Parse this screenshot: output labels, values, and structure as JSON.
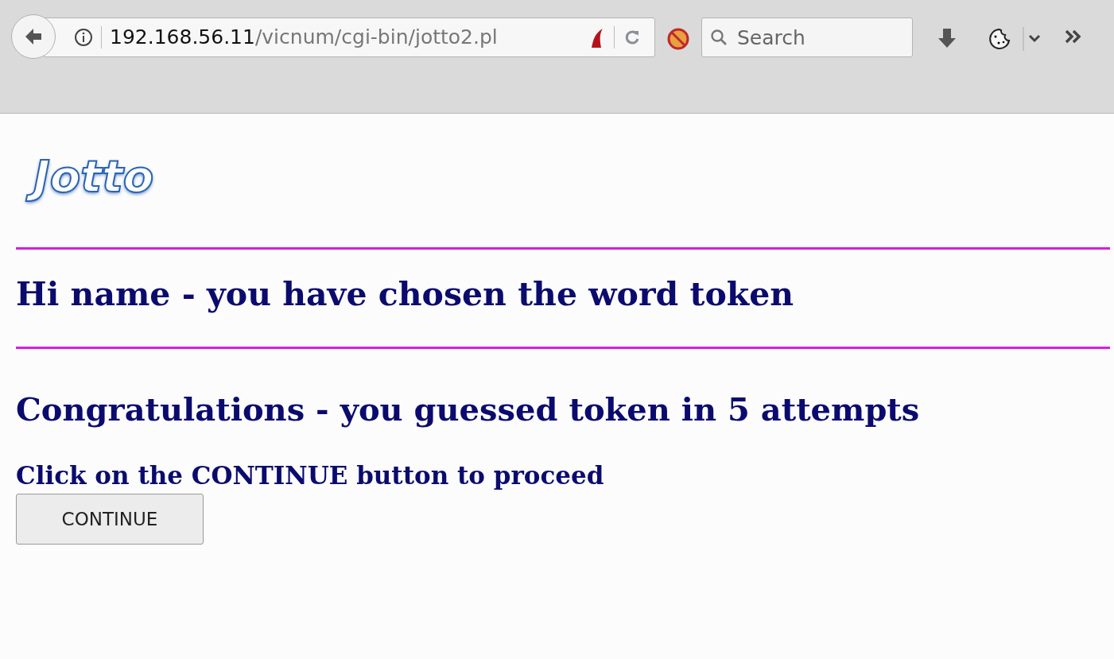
{
  "browser": {
    "url": {
      "host": "192.168.56.11",
      "path": "/vicnum/cgi-bin/jotto2.pl"
    },
    "search": {
      "placeholder": "Search"
    }
  },
  "page": {
    "logo": "Jotto",
    "greeting": "Hi name - you have chosen the word token",
    "result": "Congratulations - you guessed token in 5 attempts",
    "instruction": "Click on the CONTINUE button to proceed",
    "button": "CONTINUE"
  }
}
